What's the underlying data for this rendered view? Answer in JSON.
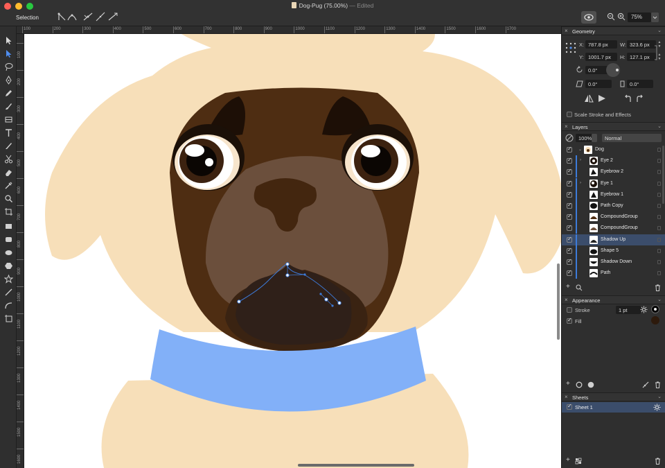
{
  "window": {
    "title": "Dog-Pug (75.00%)",
    "edited": "— Edited",
    "mode": "Selection",
    "zoom": "75%"
  },
  "ruler": {
    "top": [
      "100",
      "200",
      "300",
      "400",
      "500",
      "600",
      "700",
      "800",
      "900",
      "1000",
      "1100",
      "1200",
      "1300",
      "1400",
      "1500",
      "1600",
      "1700"
    ],
    "left": [
      "100",
      "200",
      "300",
      "400",
      "500",
      "600",
      "700",
      "800",
      "900",
      "1000",
      "1100",
      "1200",
      "1300",
      "1400",
      "1500",
      "1600"
    ]
  },
  "geometry": {
    "title": "Geometry",
    "x_label": "X:",
    "x": "787.8 px",
    "y_label": "Y:",
    "y": "1001.7 px",
    "w_label": "W:",
    "w": "323.6 px",
    "h_label": "H:",
    "h": "127.1 px",
    "rotation": "0.0°",
    "shear": "0.0°",
    "skew": "0.0°",
    "scale_stroke_label": "Scale Stroke and Effects"
  },
  "layers": {
    "title": "Layers",
    "opacity": "100%",
    "blend": "Normal",
    "items": [
      {
        "name": "Dog",
        "selected": false
      },
      {
        "name": "Eye 2",
        "selected": false
      },
      {
        "name": "Eyebrow 2",
        "selected": false
      },
      {
        "name": "Eye 1",
        "selected": false
      },
      {
        "name": "Eyebrow 1",
        "selected": false
      },
      {
        "name": "Path Copy",
        "selected": false
      },
      {
        "name": "CompoundGroup",
        "selected": false
      },
      {
        "name": "CompoundGroup",
        "selected": false
      },
      {
        "name": "Shadow Up",
        "selected": true
      },
      {
        "name": "Shape 5",
        "selected": false
      },
      {
        "name": "Shadow Down",
        "selected": false
      },
      {
        "name": "Path",
        "selected": false
      }
    ]
  },
  "appearance": {
    "title": "Appearance",
    "stroke_label": "Stroke",
    "stroke_width": "1 pt",
    "fill_label": "Fill"
  },
  "sheets": {
    "title": "Sheets",
    "items": [
      {
        "name": "Sheet 1"
      }
    ]
  },
  "colors": {
    "fawn": "#f7dfb9",
    "mask_dark": "#4e2d12",
    "muzzle": "#6b4f3c",
    "nose": "#43260f",
    "mouth_outer": "#3a2312",
    "mouth_inner": "#2f2019",
    "collar": "#82b0f8",
    "selection": "#3d7bd9",
    "fill_swatch": "#2d1a0c",
    "canvas_bg": "#ffffff"
  }
}
